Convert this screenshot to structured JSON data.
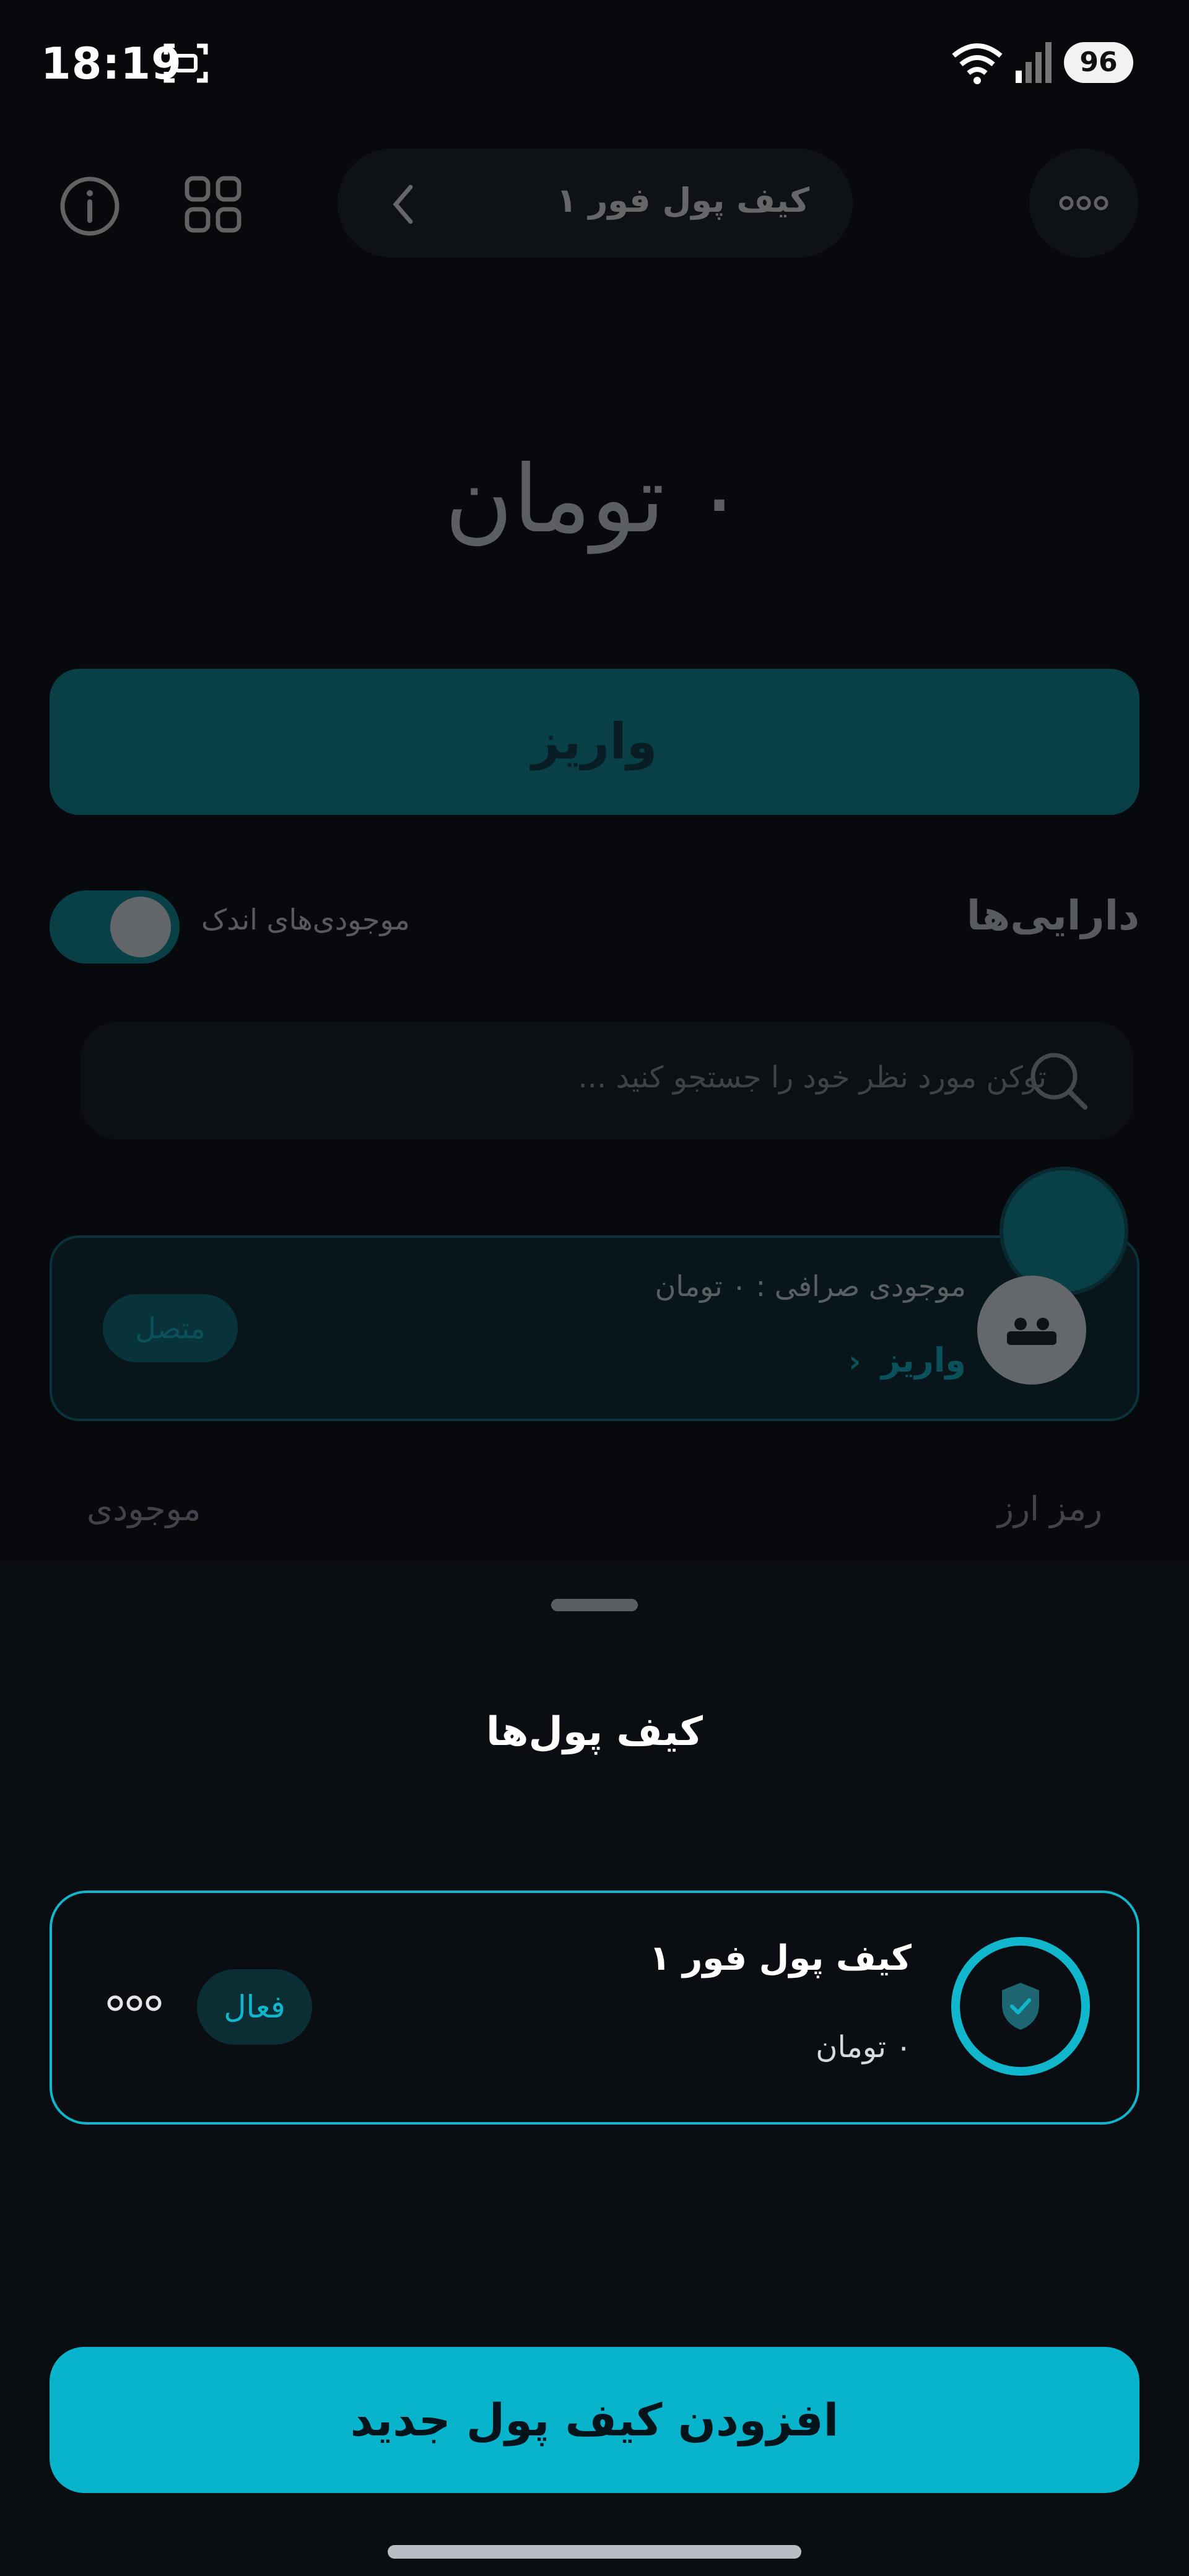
{
  "status_bar": {
    "time": "18:19",
    "battery": "96",
    "icons": [
      "screenshot-icon",
      "wifi-icon",
      "signal-icon"
    ]
  },
  "background_app": {
    "wallet_selector_label": "کیف پول فور ۱",
    "balance": "۰ تومان",
    "deposit_label": "واریز",
    "assets_title": "دارایی‌ها",
    "small_balances_label": "موجودی‌های اندک",
    "small_balances_toggle_on": true,
    "search_placeholder": "توکن مورد نظر خود را جستجو کنید ...",
    "exchange_balance_text": "موجودی صرافی : ۰ تومان",
    "exchange_deposit_link": "واریز",
    "connected_badge": "متصل",
    "column_crypto": "رمز ارز",
    "column_balance": "موجودی"
  },
  "sheet": {
    "title": "کیف پول‌ها",
    "wallets": [
      {
        "name": "کیف پول فور ۱",
        "balance": "۰ تومان",
        "status": "فعال"
      }
    ],
    "add_wallet_label": "افزودن کیف پول جدید"
  },
  "colors": {
    "accent": "#10b7cc",
    "background": "#07090d",
    "primary_button": "#08b4cc"
  }
}
